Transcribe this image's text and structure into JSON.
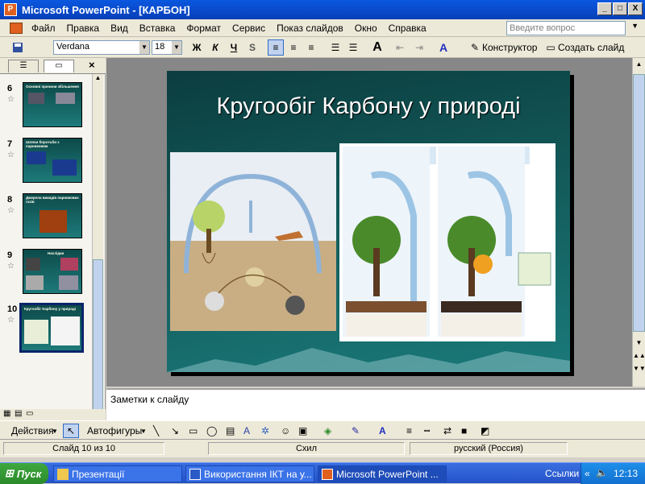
{
  "window": {
    "title": "Microsoft PowerPoint - [КАРБОН]",
    "min": "_",
    "max": "□",
    "close": "X"
  },
  "menu": {
    "items": [
      "Файл",
      "Правка",
      "Вид",
      "Вставка",
      "Формат",
      "Сервис",
      "Показ слайдов",
      "Окно",
      "Справка"
    ],
    "help_placeholder": "Введите вопрос"
  },
  "toolbar": {
    "font": "Verdana",
    "size": "18",
    "bold": "Ж",
    "italic": "К",
    "underline": "Ч",
    "shadow": "S",
    "designer": "Конструктор",
    "new_slide": "Создать слайд"
  },
  "slides": [
    {
      "num": "6",
      "title": "Основні причини збільшення"
    },
    {
      "num": "7",
      "title": "Шляхи боротьби з парниковим"
    },
    {
      "num": "8",
      "title": "Джерела викидів парникових газів"
    },
    {
      "num": "9",
      "title": "Наслідки"
    },
    {
      "num": "10",
      "title": "Кругообіг Карбону у природі"
    }
  ],
  "slide": {
    "title": "Кругообіг Карбону у природі"
  },
  "notes": {
    "text": "Заметки к слайду"
  },
  "drawbar": {
    "actions": "Действия",
    "autoshapes": "Автофигуры"
  },
  "status": {
    "slide": "Слайд 10 из 10",
    "design": "Схил",
    "lang": "русский (Россия)"
  },
  "taskbar": {
    "start": "Пуск",
    "tasks": [
      "Презентації",
      "Використання ІКТ на у...",
      "Microsoft PowerPoint ..."
    ],
    "links": "Ссылки",
    "time": "12:13"
  }
}
